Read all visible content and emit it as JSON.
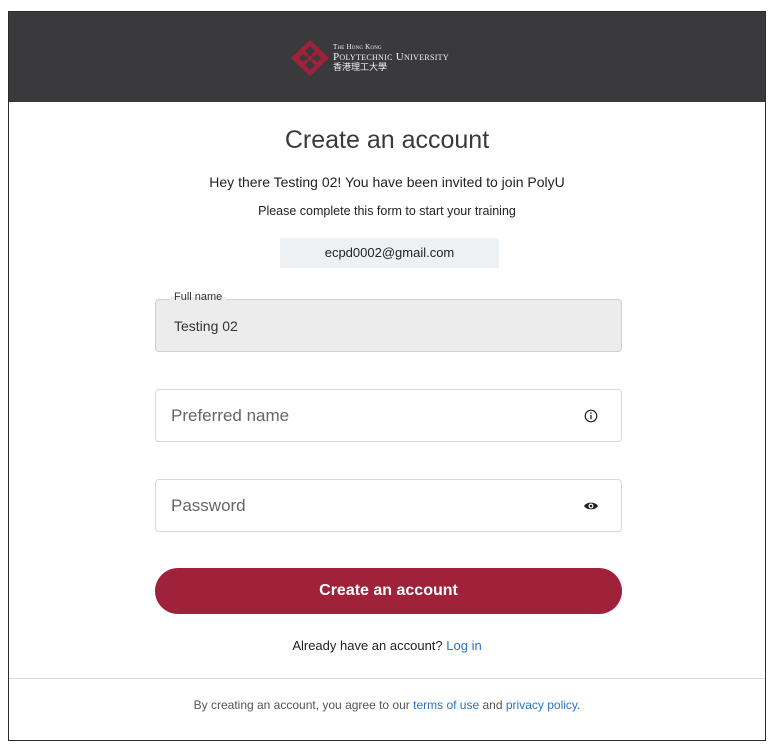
{
  "header": {
    "logo_line1": "The Hong Kong",
    "logo_line2": "Polytechnic University",
    "logo_chinese": "香港理工大學",
    "brand_color": "#a0213a",
    "background": "#3a3a3d"
  },
  "main": {
    "title": "Create an account",
    "invite_text": "Hey there Testing 02! You have been invited to join PolyU",
    "instruction_text": "Please complete this form to start your training",
    "email": "ecpd0002@gmail.com"
  },
  "form": {
    "full_name_label": "Full name",
    "full_name_value": "Testing 02",
    "preferred_name_placeholder": "Preferred name",
    "preferred_name_icon": "info-icon",
    "password_placeholder": "Password",
    "password_icon": "eye-icon",
    "submit_label": "Create an account"
  },
  "login": {
    "prompt": "Already have an account?",
    "link_label": "Log in"
  },
  "footer": {
    "prefix": "By creating an account, you agree to our",
    "terms_link": "terms of use",
    "conjunction": "and",
    "privacy_link": "privacy policy",
    "suffix": "."
  }
}
